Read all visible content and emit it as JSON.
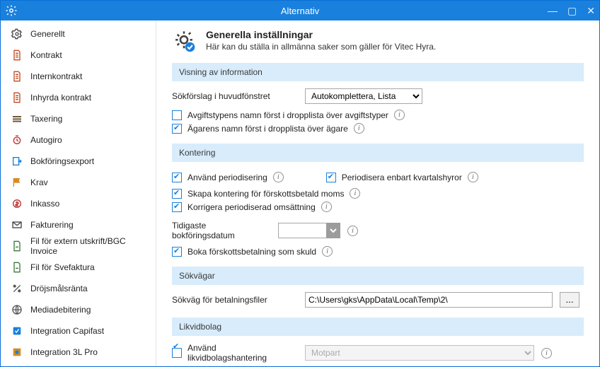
{
  "window": {
    "title": "Alternativ"
  },
  "sidebar": {
    "items": [
      {
        "id": "generellt",
        "label": "Generellt"
      },
      {
        "id": "kontrakt",
        "label": "Kontrakt"
      },
      {
        "id": "internkontrakt",
        "label": "Internkontrakt"
      },
      {
        "id": "inhyrda-kontrakt",
        "label": "Inhyrda kontrakt"
      },
      {
        "id": "taxering",
        "label": "Taxering"
      },
      {
        "id": "autogiro",
        "label": "Autogiro"
      },
      {
        "id": "bokforingsexport",
        "label": "Bokföringsexport"
      },
      {
        "id": "krav",
        "label": "Krav"
      },
      {
        "id": "inkasso",
        "label": "Inkasso"
      },
      {
        "id": "fakturering",
        "label": "Fakturering"
      },
      {
        "id": "fil-extern-utskrift",
        "label": "Fil för extern utskrift/BGC Invoice"
      },
      {
        "id": "fil-svefaktura",
        "label": "Fil för Svefaktura"
      },
      {
        "id": "drojsmalsranta",
        "label": "Dröjsmålsränta"
      },
      {
        "id": "mediadebitering",
        "label": "Mediadebitering"
      },
      {
        "id": "integration-capifast",
        "label": "Integration Capifast"
      },
      {
        "id": "integration-3l-pro",
        "label": "Integration 3L Pro"
      }
    ]
  },
  "header": {
    "title": "Generella inställningar",
    "subtitle": "Här kan du ställa in allmänna saker som gäller för Vitec Hyra."
  },
  "sections": {
    "visning": {
      "title": "Visning av information",
      "search_label": "Sökförslag i huvudfönstret",
      "search_option": "Autokomplettera, Lista",
      "chk_avgiftstypens": "Avgiftstypens namn först i dropplista över avgiftstyper",
      "chk_agarens": "Ägarens namn först i dropplista över ägare"
    },
    "kontering": {
      "title": "Kontering",
      "chk_periodisering": "Använd periodisering",
      "chk_kvartal": "Periodisera enbart kvartalshyror",
      "chk_forskottsbetald": "Skapa kontering för förskottsbetald moms",
      "chk_korrigera": "Korrigera periodiserad omsättning",
      "date_label": "Tidigaste bokföringsdatum",
      "date_value": "",
      "chk_boka_skuld": "Boka förskottsbetalning som skuld"
    },
    "sokvagar": {
      "title": "Sökvägar",
      "path_label": "Sökväg för betalningsfiler",
      "path_value": "C:\\Users\\gks\\AppData\\Local\\Temp\\2\\",
      "browse": "..."
    },
    "likvidbolag": {
      "title": "Likvidbolag",
      "chk_anvand": "Använd likvidbolagshantering",
      "select_value": "Motpart"
    }
  }
}
